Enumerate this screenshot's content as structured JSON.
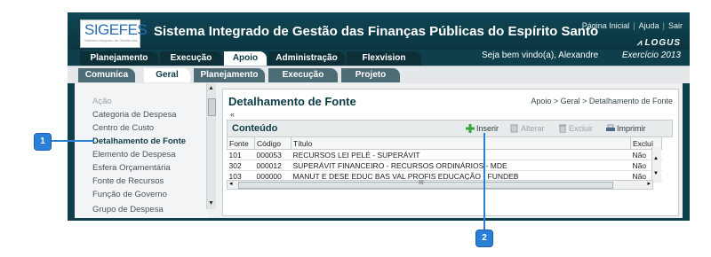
{
  "header": {
    "logo_text": "SIGEFES",
    "logo_subtext": "Sistema Integrado de Gestão das Finanças Públicas do Espírito Santo",
    "title": "Sistema Integrado de Gestão das Finanças Públicas do Espírito Santo",
    "links": [
      "Página Inicial",
      "Ajuda",
      "Sair"
    ],
    "brand": "LOGUS",
    "welcome": "Seja bem vindo(a), Alexandre",
    "exercise": "Exercício 2013"
  },
  "main_tabs": [
    "Planejamento",
    "Execução",
    "Apoio",
    "Administração",
    "Flexvision"
  ],
  "sub_tabs": [
    "Comunica",
    "Geral",
    "Planejamento",
    "Execução",
    "Projeto"
  ],
  "sidebar": {
    "items": [
      "Ação",
      "Categoria de Despesa",
      "Centro de Custo",
      "Detalhamento de Fonte",
      "Elemento de Despesa",
      "Esfera Orçamentária",
      "Fonte de Recursos",
      "Função de Governo",
      "Grupo de Despesa"
    ]
  },
  "content": {
    "page_title": "Detalhamento de Fonte",
    "breadcrumb": "Apoio > Geral > Detalhamento de Fonte",
    "collapse_icon": "«",
    "grid_title": "Conteúdo",
    "toolbar": {
      "insert": "Inserir",
      "edit": "Alterar",
      "delete": "Excluir",
      "print": "Imprimir"
    },
    "columns": [
      "Fonte",
      "Código",
      "Título",
      "Excluí"
    ],
    "rows": [
      [
        "101",
        "000053",
        "RECURSOS LEI PELÉ - SUPERÁVIT",
        "Não"
      ],
      [
        "302",
        "000012",
        "SUPERÁVIT FINANCEIRO - RECURSOS ORDINÁRIOS - MDE",
        "Não"
      ],
      [
        "103",
        "000000",
        "MANUT E DESE EDUC BAS VAL PROFIS EDUCAÇÃO - FUNDEB",
        "Não"
      ]
    ],
    "hscroll_label": "III"
  },
  "callouts": [
    "1",
    "2"
  ],
  "colors": {
    "header": "#0f4655",
    "accent": "#2a7fd6",
    "active_text": "#0d3b46"
  }
}
